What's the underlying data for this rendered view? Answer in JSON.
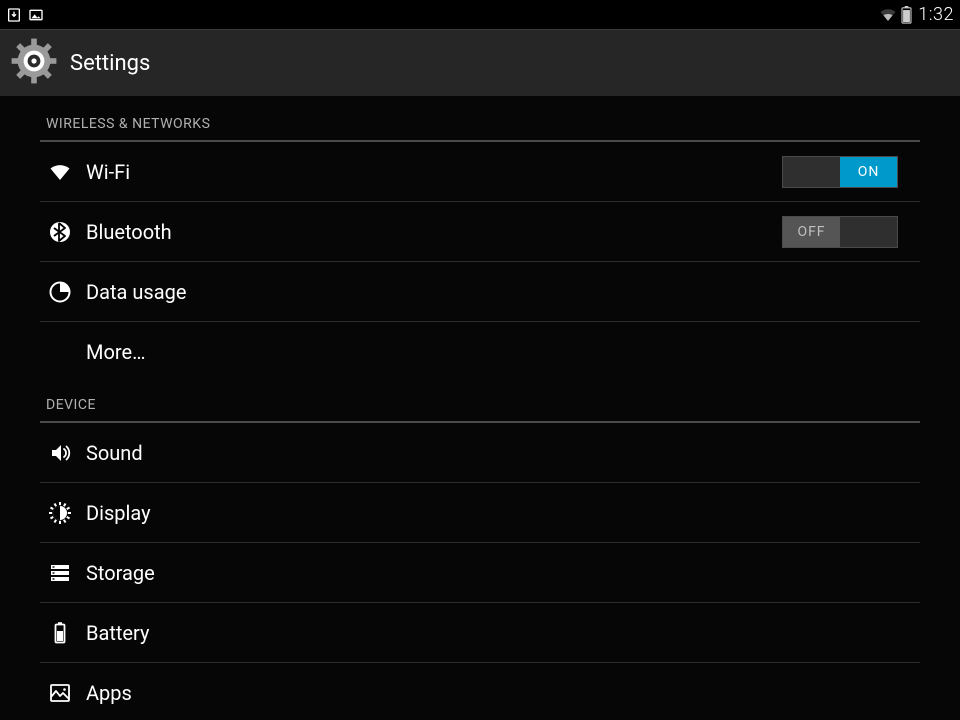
{
  "status": {
    "time": "1:32"
  },
  "header": {
    "title": "Settings"
  },
  "sections": {
    "wireless": {
      "title": "WIRELESS & NETWORKS",
      "wifi": {
        "label": "Wi-Fi",
        "toggle_state": "on",
        "toggle_text": "ON"
      },
      "bluetooth": {
        "label": "Bluetooth",
        "toggle_state": "off",
        "toggle_text": "OFF"
      },
      "data_usage": {
        "label": "Data usage"
      },
      "more": {
        "label": "More…"
      }
    },
    "device": {
      "title": "DEVICE",
      "sound": {
        "label": "Sound"
      },
      "display": {
        "label": "Display"
      },
      "storage": {
        "label": "Storage"
      },
      "battery": {
        "label": "Battery"
      },
      "apps": {
        "label": "Apps"
      }
    }
  }
}
